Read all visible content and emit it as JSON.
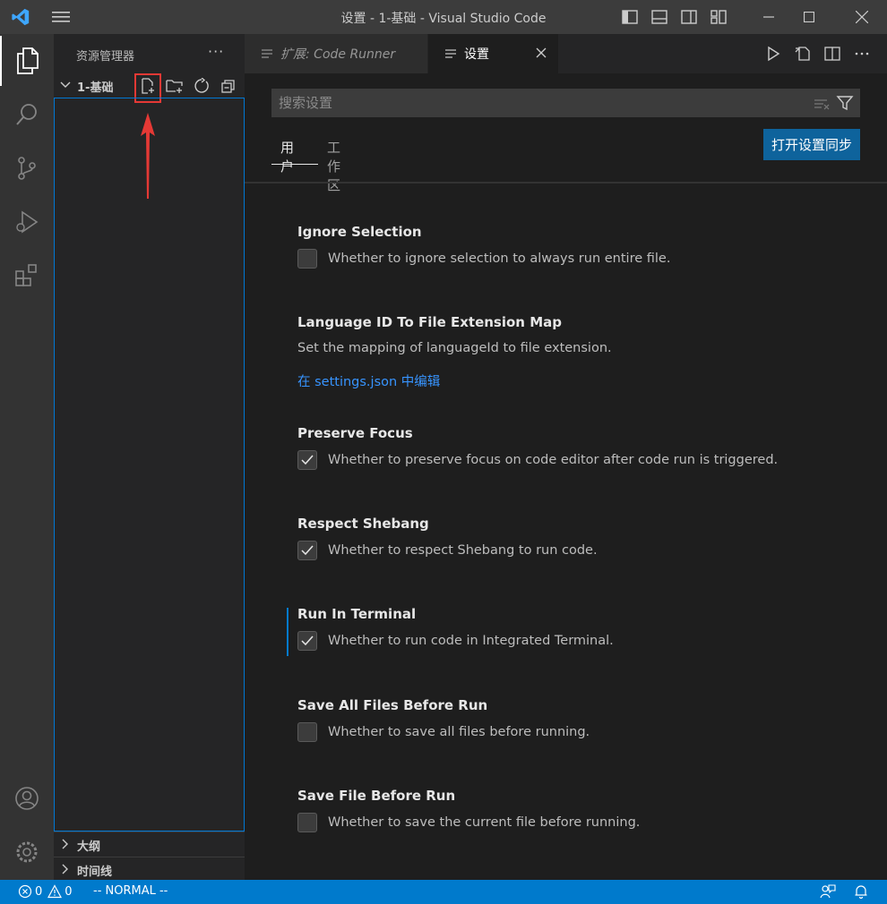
{
  "window": {
    "title": "设置 - 1-基础 - Visual Studio Code"
  },
  "sidebar": {
    "title": "资源管理器",
    "more": "···",
    "folder": "1-基础",
    "sections": [
      "大纲",
      "时间线"
    ]
  },
  "tabs": [
    {
      "label": "扩展: Code Runner"
    },
    {
      "label": "设置"
    }
  ],
  "search": {
    "placeholder": "搜索设置"
  },
  "scope_tabs": [
    "用户",
    "工作区"
  ],
  "sync_button": "打开设置同步",
  "settings": [
    {
      "name": "Ignore Selection",
      "description": "Whether to ignore selection to always run entire file.",
      "checked": false
    },
    {
      "name": "Language ID To File Extension Map",
      "description": "Set the mapping of languageId to file extension.",
      "link": "在 settings.json 中编辑"
    },
    {
      "name": "Preserve Focus",
      "description": "Whether to preserve focus on code editor after code run is triggered.",
      "checked": true
    },
    {
      "name": "Respect Shebang",
      "description": "Whether to respect Shebang to run code.",
      "checked": true
    },
    {
      "name": "Run In Terminal",
      "description": "Whether to run code in Integrated Terminal.",
      "checked": true
    },
    {
      "name": "Save All Files Before Run",
      "description": "Whether to save all files before running.",
      "checked": false
    },
    {
      "name": "Save File Before Run",
      "description": "Whether to save the current file before running.",
      "checked": false
    }
  ],
  "statusbar": {
    "errors": "0",
    "warnings": "0",
    "mode": "-- NORMAL --"
  },
  "colors": {
    "accent": "#007acc",
    "button": "#0e639c",
    "link": "#3794ff",
    "highlight": "#e53935"
  }
}
